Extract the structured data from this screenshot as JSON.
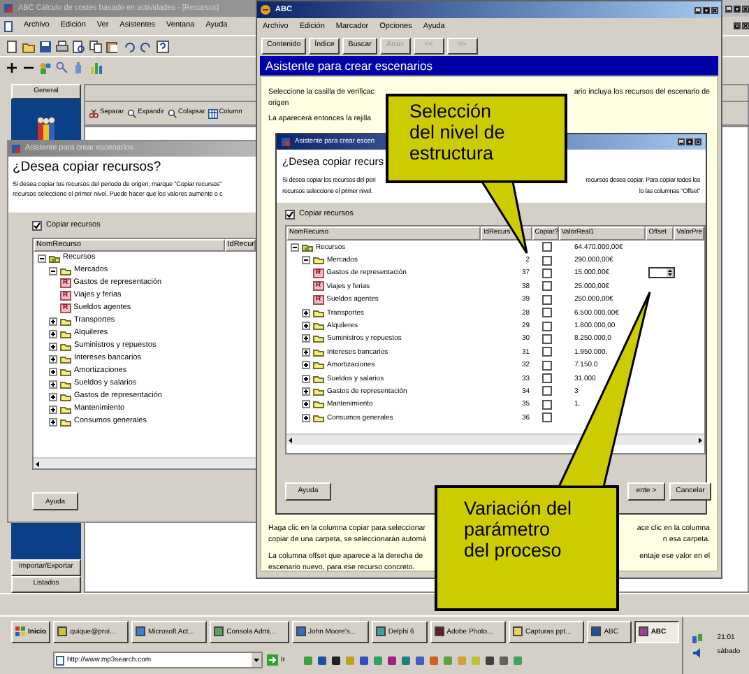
{
  "app_window": {
    "title": "ABC Cálculo de costes basado en actividades - [Recursos]",
    "menu": [
      "Archivo",
      "Edición",
      "Ver",
      "Asistentes",
      "Ventana",
      "Ayuda"
    ],
    "view_toolbar": [
      {
        "label": "Separar"
      },
      {
        "label": "Expandir"
      },
      {
        "label": "Colapsar"
      },
      {
        "label": "Column"
      }
    ],
    "sidebar": {
      "header": "General",
      "footer_items": [
        "Importar/Exportar",
        "Listados"
      ]
    }
  },
  "left_dialog": {
    "title": "Asistente para crear escenarios",
    "heading": "¿Desea copiar recursos?",
    "text": [
      "Si desea copiar los recursos del periodo de origen, marque \"Copiar recursos\"",
      "recursos seleccione el primer nivel. Puede hacer que los valores aumente o c"
    ],
    "copy_checkbox": {
      "label": "Copiar recursos",
      "checked": true
    },
    "columns": [
      "NomRecurso",
      "IdRecur"
    ],
    "tree": [
      {
        "name": "Recursos",
        "kind": "root",
        "expanded": true,
        "children": [
          {
            "name": "Mercados",
            "kind": "folder",
            "expanded": true,
            "children": [
              {
                "name": "Gastos de representación",
                "kind": "resource",
                "badge": "R"
              },
              {
                "name": "Viajes y ferias",
                "kind": "resource",
                "badge": "R"
              },
              {
                "name": "Sueldos agentes",
                "kind": "resource",
                "badge": "R"
              }
            ]
          },
          {
            "name": "Transportes",
            "kind": "folder",
            "expanded": false
          },
          {
            "name": "Alquileres",
            "kind": "folder",
            "expanded": false
          },
          {
            "name": "Suministros y repuestos",
            "kind": "folder",
            "expanded": false
          },
          {
            "name": "Intereses bancarios",
            "kind": "folder",
            "expanded": false
          },
          {
            "name": "Amortizaciones",
            "kind": "folder",
            "expanded": false
          },
          {
            "name": "Sueldos y salarios",
            "kind": "folder",
            "expanded": false
          },
          {
            "name": "Gastos de representación",
            "kind": "folder",
            "expanded": false
          },
          {
            "name": "Mantenimiento",
            "kind": "folder",
            "expanded": false
          },
          {
            "name": "Consumos generales",
            "kind": "folder",
            "expanded": false
          }
        ]
      }
    ],
    "buttons": [
      "Ayuda"
    ]
  },
  "help_window": {
    "title": "ABC",
    "menu": [
      "Archivo",
      "Edición",
      "Marcador",
      "Opciones",
      "Ayuda"
    ],
    "buttons": [
      {
        "label": "Contenido",
        "disabled": false
      },
      {
        "label": "Índice",
        "disabled": false
      },
      {
        "label": "Buscar",
        "disabled": false
      },
      {
        "label": "Atrás",
        "disabled": true
      },
      {
        "label": "<<",
        "disabled": true
      },
      {
        "label": ">>",
        "disabled": true
      }
    ],
    "heading": "Asistente para crear escenarios",
    "intro": [
      [
        "Seleccione la casilla de verificac",
        "ario incluya los recursos del escenario de"
      ],
      [
        "origen"
      ],
      [
        "La aparecerá entonces la rejilla"
      ]
    ],
    "dialog": {
      "title": "Asistente para crear escen",
      "heading": "¿Desea copiar recurs",
      "text": [
        [
          "Si desea copiar los recursos del peri",
          "recursos desea copiar. Para copiar todos los"
        ],
        [
          "recursos seleccione el primer nivel.",
          "lo las columnas \"Offset\""
        ]
      ],
      "copy_checkbox": {
        "label": "Copiar recursos",
        "checked": true
      },
      "columns": [
        "NomRecurso",
        "IdRecurs",
        "Copiar?",
        "ValorReal1",
        "Offset",
        "ValorPre"
      ],
      "tree": [
        {
          "name": "Recursos",
          "kind": "root",
          "expanded": true,
          "copy": false,
          "editing": false,
          "value": "64.470.000,00€",
          "children": [
            {
              "name": "Mercados",
              "kind": "folder",
              "expanded": true,
              "id": "2",
              "copy": false,
              "editing": false,
              "value": "290.000,00€",
              "children": [
                {
                  "name": "Gastos de representación",
                  "kind": "resource",
                  "badge": "R",
                  "id": "37",
                  "copy": false,
                  "editing": true,
                  "value": "15.000,00€"
                },
                {
                  "name": "Viajes y ferias",
                  "kind": "resource",
                  "badge": "R",
                  "id": "38",
                  "copy": false,
                  "editing": false,
                  "value": "25.000,00€"
                },
                {
                  "name": "Sueldos agentes",
                  "kind": "resource",
                  "badge": "R",
                  "id": "39",
                  "copy": false,
                  "editing": false,
                  "value": "250.000,00€"
                }
              ]
            },
            {
              "name": "Transportes",
              "kind": "folder",
              "expanded": false,
              "id": "28",
              "copy": false,
              "editing": false,
              "value": "6.500.000,00€"
            },
            {
              "name": "Alquileres",
              "kind": "folder",
              "expanded": false,
              "id": "29",
              "copy": false,
              "editing": false,
              "value": "1.800.000,00"
            },
            {
              "name": "Suministros y repuestos",
              "kind": "folder",
              "expanded": false,
              "id": "30",
              "copy": false,
              "editing": false,
              "value": "8.250.000,0"
            },
            {
              "name": "Intereses bancarios",
              "kind": "folder",
              "expanded": false,
              "id": "31",
              "copy": false,
              "editing": false,
              "value": "1.950.000,"
            },
            {
              "name": "Amortizaciones",
              "kind": "folder",
              "expanded": false,
              "id": "32",
              "copy": false,
              "editing": false,
              "value": "7.150.0"
            },
            {
              "name": "Sueldos y salarios",
              "kind": "folder",
              "expanded": false,
              "id": "33",
              "copy": false,
              "editing": false,
              "value": "31.000"
            },
            {
              "name": "Gastos de representación",
              "kind": "folder",
              "expanded": false,
              "id": "34",
              "copy": false,
              "editing": false,
              "value": "3"
            },
            {
              "name": "Mantenimiento",
              "kind": "folder",
              "expanded": false,
              "id": "35",
              "copy": false,
              "editing": false,
              "value": "1."
            },
            {
              "name": "Consumos generales",
              "kind": "folder",
              "expanded": false,
              "id": "36",
              "copy": false,
              "editing": false
            }
          ]
        }
      ],
      "buttons": [
        {
          "label": "Ayuda",
          "kind": "help"
        },
        {
          "label": "ente >",
          "kind": "next"
        },
        {
          "label": "Cancelar",
          "kind": "cancel"
        }
      ]
    },
    "notes": [
      [
        "Haga clic en la columna copiar para seleccionar",
        "ace clic en la columna"
      ],
      [
        "copiar de una carpeta, se seleccionarán automá",
        "n esa carpeta."
      ],
      [
        "La columna offset que aparece a la derecha de",
        "entaje ese valor en el"
      ],
      [
        "escenario nuevo, para ese recurso concreto."
      ]
    ]
  },
  "callouts": [
    {
      "text": "Selección\ndel nivel de\nestructura"
    },
    {
      "text": "Variación del\nparámetro\ndel proceso"
    }
  ],
  "taskbar": {
    "start": "Inicio",
    "tasks": [
      {
        "label": "quique@proi...",
        "selected": false
      },
      {
        "label": "Microsoft Act...",
        "selected": false
      },
      {
        "label": "Consola Admi...",
        "selected": false
      },
      {
        "label": "John Moore's...",
        "selected": false
      },
      {
        "label": "Delphi 6",
        "selected": false
      },
      {
        "label": "Adobe Photo...",
        "selected": false
      },
      {
        "label": "Capturas ppt...",
        "selected": false
      },
      {
        "label": "ABC",
        "selected": false
      },
      {
        "label": "ABC",
        "selected": true
      }
    ],
    "address": "http://www.mp3search.com",
    "go": "Ir",
    "time": "21:01",
    "day": "sábado"
  }
}
